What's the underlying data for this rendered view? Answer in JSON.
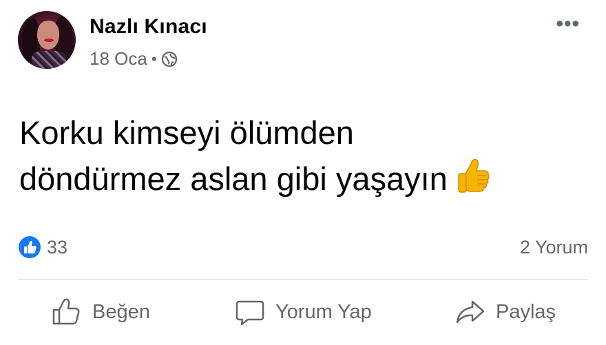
{
  "post": {
    "author_name": "Nazlı Kınacı",
    "date": "18 Oca",
    "separator": "•",
    "visibility_icon": "globe-icon",
    "more_label": "•••",
    "text_line_1": "Korku kimseyi ölümden",
    "text_line_2": "döndürmez aslan gibi yaşayın",
    "text_emoji": "thumbs-up-emoji"
  },
  "stats": {
    "like_count": "33",
    "comment_count_label": "2 Yorum"
  },
  "actions": {
    "like_label": "Beğen",
    "comment_label": "Yorum Yap",
    "share_label": "Paylaş"
  },
  "colors": {
    "text_primary": "#050505",
    "text_secondary": "#65676b",
    "like_blue": "#1877f2",
    "divider": "#dadde1",
    "emoji_yellow": "#f7b500"
  }
}
